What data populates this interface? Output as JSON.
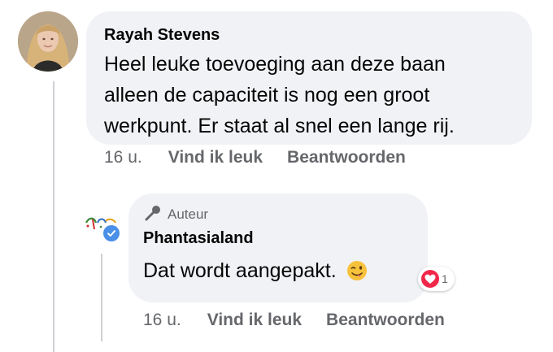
{
  "comment": {
    "author": "Rayah Stevens",
    "lines": [
      "Heel leuke toevoeging aan deze baan",
      "alleen de capaciteit is nog een groot",
      "werkpunt. Er staat al snel een lange rij."
    ],
    "time": "16 u.",
    "like_label": "Vind ik leuk",
    "reply_label": "Beantwoorden"
  },
  "reply": {
    "badge_label": "Auteur",
    "author": "Phantasialand",
    "text": "Dat wordt aangepakt.",
    "emoji": "winking-face-with-tongue",
    "reaction": {
      "type": "heart",
      "count": "1",
      "color": "#f0284a"
    },
    "time": "16 u.",
    "like_label": "Vind ik leuk",
    "reply_label": "Beantwoorden"
  },
  "colors": {
    "bubble": "#f0f2f5",
    "secondary_text": "#65676b",
    "verified": "#4a8fe8",
    "thread_line": "#ced0d4"
  }
}
